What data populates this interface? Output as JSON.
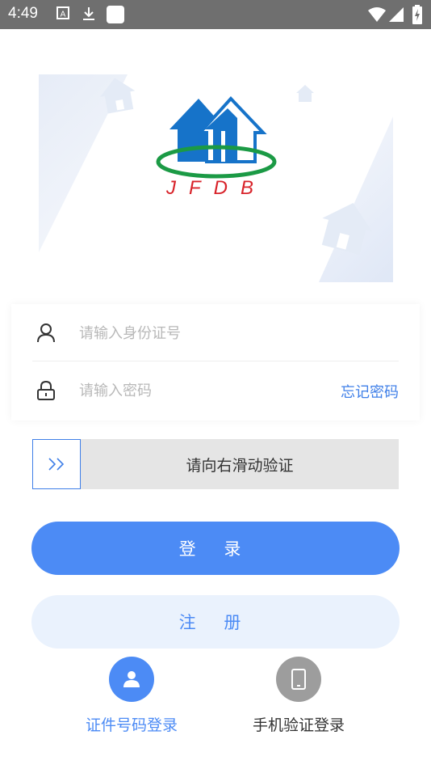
{
  "status_bar": {
    "time": "4:49",
    "icons": [
      "a-notification-icon",
      "download-icon",
      "app-notification-icon",
      "wifi-icon",
      "signal-icon",
      "battery-icon"
    ]
  },
  "logo": {
    "text": "JFDB"
  },
  "form": {
    "id_placeholder": "请输入身份证号",
    "password_placeholder": "请输入密码",
    "forgot_password": "忘记密码"
  },
  "slider": {
    "handle_glyph": "»",
    "text": "请向右滑动验证"
  },
  "buttons": {
    "login": "登 录",
    "register": "注 册"
  },
  "login_methods": [
    {
      "label": "证件号码登录",
      "icon": "user-icon",
      "active": true
    },
    {
      "label": "手机验证登录",
      "icon": "phone-icon",
      "active": false
    }
  ],
  "colors": {
    "primary": "#4c8bf5",
    "logo_blue": "#1673c9",
    "logo_green": "#1b9a45",
    "logo_red": "#d8232a"
  }
}
